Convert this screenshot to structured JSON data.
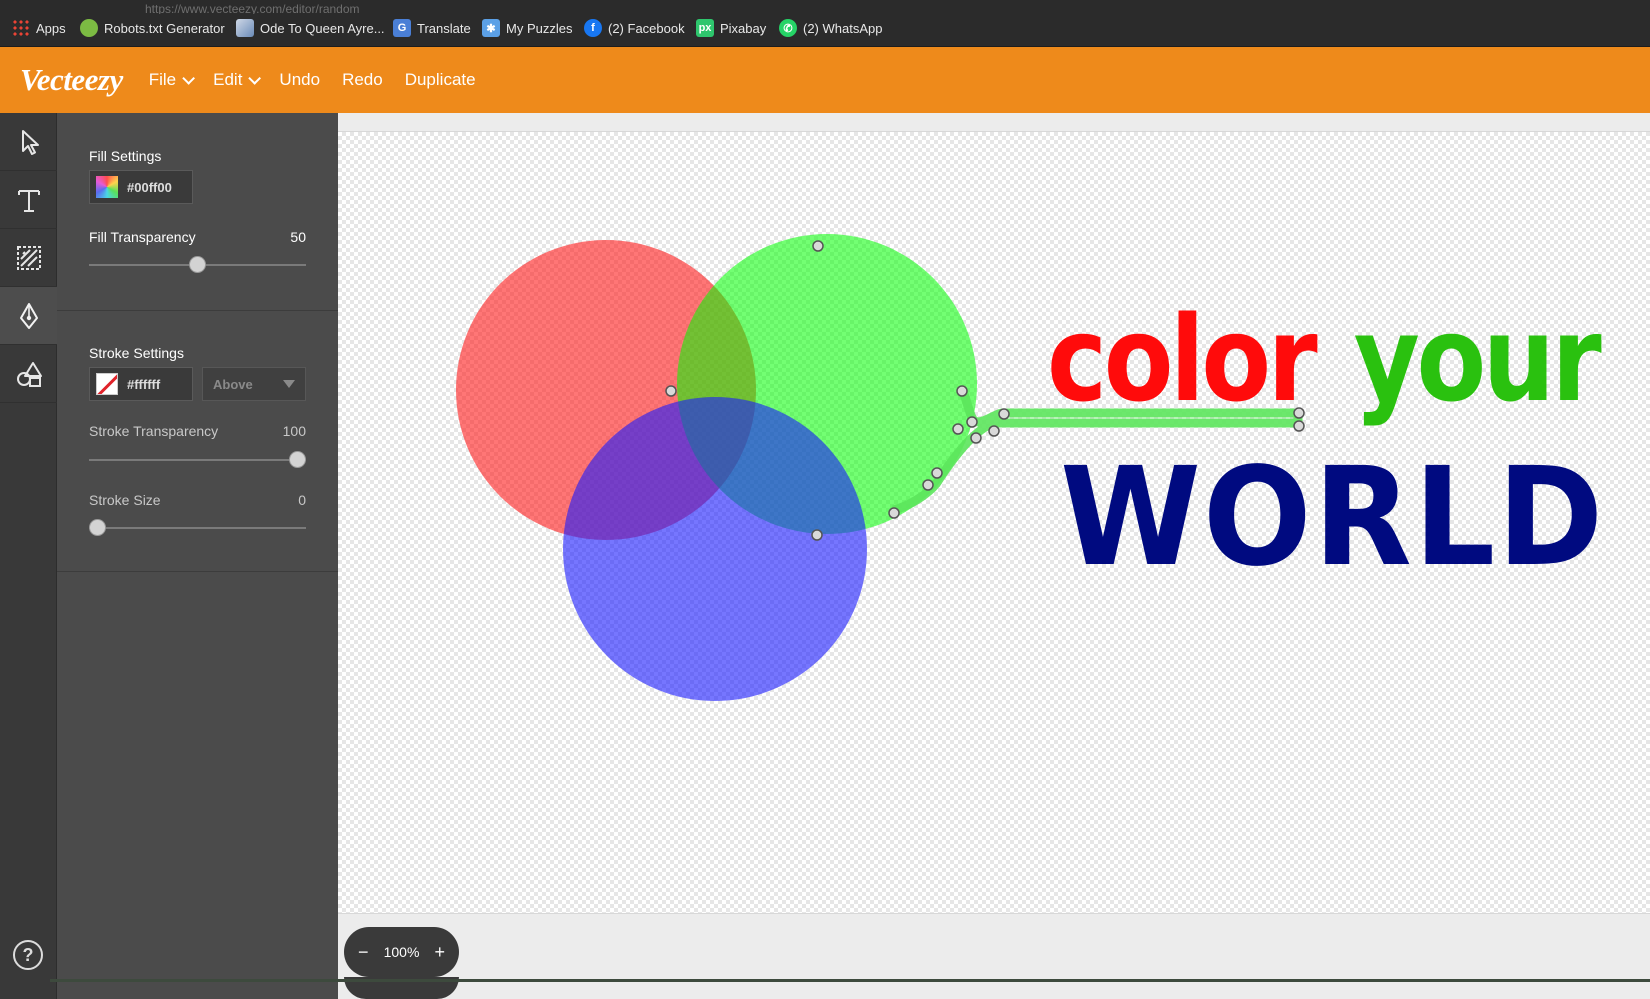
{
  "browser": {
    "faded_url": "https://www.vecteezy.com/editor/random",
    "bookmarks": [
      {
        "label": "Apps",
        "icon": "apps-grid-icon"
      },
      {
        "label": "Robots.txt Generator",
        "icon": "robots-icon"
      },
      {
        "label": "Ode To Queen Ayre...",
        "icon": "page-icon"
      },
      {
        "label": "Translate",
        "icon": "translate-icon"
      },
      {
        "label": "My Puzzles",
        "icon": "puzzle-icon"
      },
      {
        "label": "(2) Facebook",
        "icon": "facebook-icon"
      },
      {
        "label": "Pixabay",
        "icon": "pixabay-icon"
      },
      {
        "label": "(2) WhatsApp",
        "icon": "whatsapp-icon"
      }
    ]
  },
  "header": {
    "logo": "Vecteezy",
    "menu": [
      {
        "label": "File",
        "dropdown": true
      },
      {
        "label": "Edit",
        "dropdown": true
      },
      {
        "label": "Undo",
        "dropdown": false
      },
      {
        "label": "Redo",
        "dropdown": false
      },
      {
        "label": "Duplicate",
        "dropdown": false
      }
    ],
    "accent_color": "#ee8a1b"
  },
  "tools": [
    {
      "name": "select",
      "icon": "cursor-arrow-icon",
      "active": false
    },
    {
      "name": "text",
      "icon": "text-icon",
      "active": false
    },
    {
      "name": "image",
      "icon": "image-pattern-icon",
      "active": false
    },
    {
      "name": "pen",
      "icon": "pen-nib-icon",
      "active": true
    },
    {
      "name": "shapes",
      "icon": "shapes-icon",
      "active": false
    }
  ],
  "fill": {
    "title": "Fill Settings",
    "color_hex": "#00ff00",
    "transparency_label": "Fill Transparency",
    "transparency_value": "50",
    "transparency_fraction": 0.5
  },
  "stroke": {
    "title": "Stroke Settings",
    "color_hex": "#ffffff",
    "position": "Above",
    "transparency_label": "Stroke Transparency",
    "transparency_value": "100",
    "transparency_fraction": 1.0,
    "size_label": "Stroke Size",
    "size_value": "0",
    "size_fraction": 0.0
  },
  "canvas": {
    "text_line1_word1": "color",
    "text_line1_word2": "your",
    "text_line2": "WORLD",
    "colors": {
      "red_circle": "#ff1a1a",
      "green_circle": "#00ff00",
      "blue_circle": "#1a1aff",
      "word_color": "#ff0b0b",
      "word_your": "#2ac10f",
      "word_world": "#000a80"
    }
  },
  "zoom": {
    "level": "100%",
    "minus": "−",
    "plus": "+"
  },
  "help": {
    "icon": "help-icon",
    "label": "?"
  }
}
